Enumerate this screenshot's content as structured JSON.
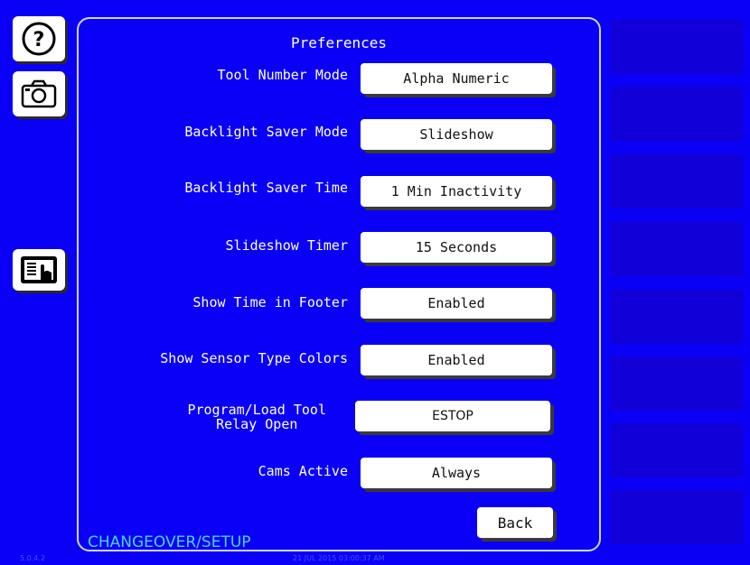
{
  "side": {
    "help_icon": "question-circle",
    "camera_icon": "camera",
    "touch_icon": "touch-screen-hand"
  },
  "panel": {
    "title": "Preferences",
    "rows": [
      {
        "label": "Tool Number Mode",
        "value": "Alpha Numeric"
      },
      {
        "label": "Backlight Saver Mode",
        "value": "Slideshow"
      },
      {
        "label": "Backlight Saver Time",
        "value": "1 Min Inactivity"
      },
      {
        "label": "Slideshow Timer",
        "value": "15 Seconds"
      },
      {
        "label": "Show Time in Footer",
        "value": "Enabled"
      },
      {
        "label": "Show Sensor Type Colors",
        "value": "Enabled"
      },
      {
        "label": "Program/Load Tool Relay Open",
        "label_line1": "Program/Load Tool",
        "label_line2": "Relay Open",
        "value": "ESTOP"
      },
      {
        "label": "Cams Active",
        "value": "Always"
      }
    ],
    "back_label": "Back",
    "footer_label": "CHANGEOVER/SETUP"
  },
  "footer": {
    "version": "5.0.4.2",
    "datetime": "21 JUL 2015 03:00:37 AM"
  },
  "colors": {
    "background": "#0a00f5",
    "footer_label": "#4fd3ff",
    "panel_border": "#cfd4ff"
  }
}
